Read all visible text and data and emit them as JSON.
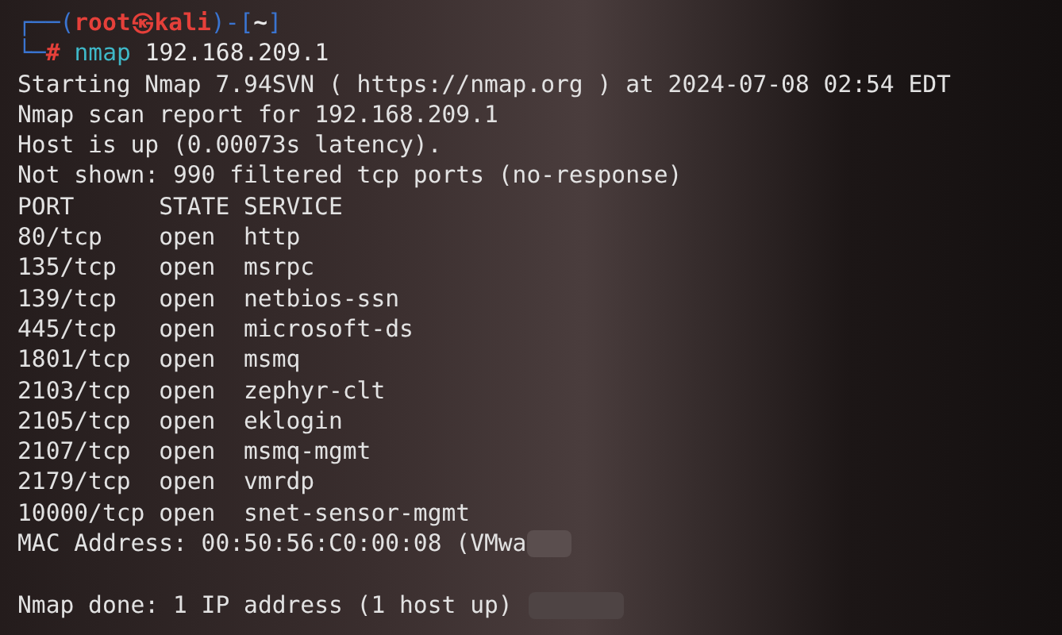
{
  "prompt": {
    "line1": [
      {
        "kind": "frame",
        "text": "┌──("
      },
      {
        "kind": "user",
        "text": "root㉿kali"
      },
      {
        "kind": "frame",
        "text": ")-["
      },
      {
        "kind": "path",
        "text": "~"
      },
      {
        "kind": "frame",
        "text": "]"
      }
    ],
    "line2": [
      {
        "kind": "frame",
        "text": "└─"
      },
      {
        "kind": "symbol",
        "text": "#"
      },
      {
        "kind": "command",
        "text": "nmap"
      },
      {
        "kind": "arg",
        "text": "192.168.209.1"
      }
    ]
  },
  "output_before": [
    "Starting Nmap 7.94SVN ( https://nmap.org ) at 2024-07-08 02:54 EDT",
    "Nmap scan report for 192.168.209.1",
    "Host is up (0.00073s latency).",
    "Not shown: 990 filtered tcp ports (no-response)"
  ],
  "table": {
    "columns": [
      "PORT",
      "STATE",
      "SERVICE"
    ],
    "rows": [
      {
        "port": "80/tcp",
        "state": "open",
        "service": "http"
      },
      {
        "port": "135/tcp",
        "state": "open",
        "service": "msrpc"
      },
      {
        "port": "139/tcp",
        "state": "open",
        "service": "netbios-ssn"
      },
      {
        "port": "445/tcp",
        "state": "open",
        "service": "microsoft-ds"
      },
      {
        "port": "1801/tcp",
        "state": "open",
        "service": "msmq"
      },
      {
        "port": "2103/tcp",
        "state": "open",
        "service": "zephyr-clt"
      },
      {
        "port": "2105/tcp",
        "state": "open",
        "service": "eklogin"
      },
      {
        "port": "2107/tcp",
        "state": "open",
        "service": "msmq-mgmt"
      },
      {
        "port": "2179/tcp",
        "state": "open",
        "service": "vmrdp"
      },
      {
        "port": "10000/tcp",
        "state": "open",
        "service": "snet-sensor-mgmt"
      }
    ]
  },
  "mac_line": "MAC Address: 00:50:56:C0:00:08 (VMwa",
  "done_line": "Nmap done: 1 IP address (1 host up)"
}
